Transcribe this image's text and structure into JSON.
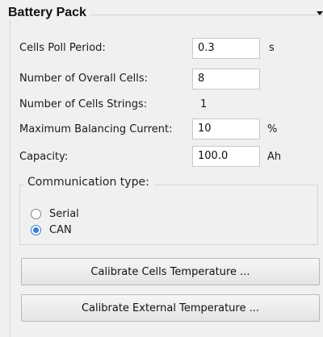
{
  "group_title": "Battery Pack",
  "fields": {
    "cells_poll_period": {
      "label": "Cells Poll Period:",
      "value": "0.3",
      "unit": "s"
    },
    "number_of_overall_cells": {
      "label": "Number of Overall Cells:",
      "value": "8"
    },
    "number_of_cells_strings": {
      "label": "Number of Cells Strings:",
      "value": "1"
    },
    "max_balancing_current": {
      "label": "Maximum Balancing Current:",
      "value": "10",
      "unit": "%"
    },
    "capacity": {
      "label": "Capacity:",
      "value": "100.0",
      "unit": "Ah"
    }
  },
  "communication": {
    "title": "Communication type:",
    "options": [
      {
        "label": "Serial",
        "checked": false
      },
      {
        "label": "CAN",
        "checked": true
      }
    ]
  },
  "buttons": {
    "calibrate_cells": "Calibrate Cells Temperature ...",
    "calibrate_external": "Calibrate External Temperature ..."
  },
  "colors": {
    "accent": "#3a7bd5"
  }
}
